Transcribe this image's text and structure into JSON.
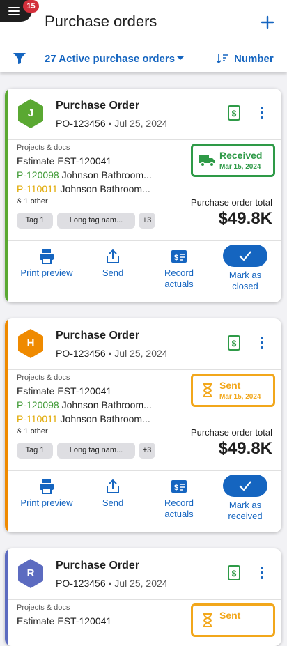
{
  "header": {
    "title": "Purchase orders",
    "menu_badge": "15",
    "filter_label": "27 Active purchase orders",
    "sort_label": "Number"
  },
  "colors": {
    "accent": "#1565c0",
    "green": "#3f9a35",
    "orange": "#ef8a00",
    "purple": "#5c6bc0",
    "received": "#2e9a47",
    "sent": "#f2a71b"
  },
  "cards": [
    {
      "avatar": "J",
      "avatar_color": "#5aa832",
      "title": "Purchase Order",
      "number": "PO-123456",
      "date": "Jul 25, 2024",
      "projects_label": "Projects & docs",
      "estimate": "Estimate EST-120041",
      "p1_code": "P-120098",
      "p1_name": "Johnson Bathroom...",
      "p2_code": "P-110011",
      "p2_name": "Johnson Bathroom...",
      "other": "& 1 other",
      "tags": [
        "Tag 1",
        "Long tag nam...",
        "+3"
      ],
      "status": "Received",
      "status_icon": "truck-icon",
      "status_date": "Mar 15, 2024",
      "total_label": "Purchase order total",
      "total": "$49.8K",
      "actions": [
        "Print preview",
        "Send",
        "Record actuals",
        "Mark as closed"
      ]
    },
    {
      "avatar": "H",
      "avatar_color": "#ef8a00",
      "title": "Purchase Order",
      "number": "PO-123456",
      "date": "Jul 25, 2024",
      "projects_label": "Projects & docs",
      "estimate": "Estimate EST-120041",
      "p1_code": "P-120098",
      "p1_name": "Johnson Bathroom...",
      "p2_code": "P-110011",
      "p2_name": "Johnson Bathroom...",
      "other": "& 1 other",
      "tags": [
        "Tag 1",
        "Long tag nam...",
        "+3"
      ],
      "status": "Sent",
      "status_icon": "hourglass-icon",
      "status_date": "Mar 15, 2024",
      "total_label": "Purchase order total",
      "total": "$49.8K",
      "actions": [
        "Print preview",
        "Send",
        "Record actuals",
        "Mark as received"
      ]
    },
    {
      "avatar": "R",
      "avatar_color": "#5c6bc0",
      "title": "Purchase Order",
      "number": "PO-123456",
      "date": "Jul 25, 2024",
      "projects_label": "Projects & docs",
      "estimate": "Estimate EST-120041",
      "status": "Sent"
    }
  ]
}
